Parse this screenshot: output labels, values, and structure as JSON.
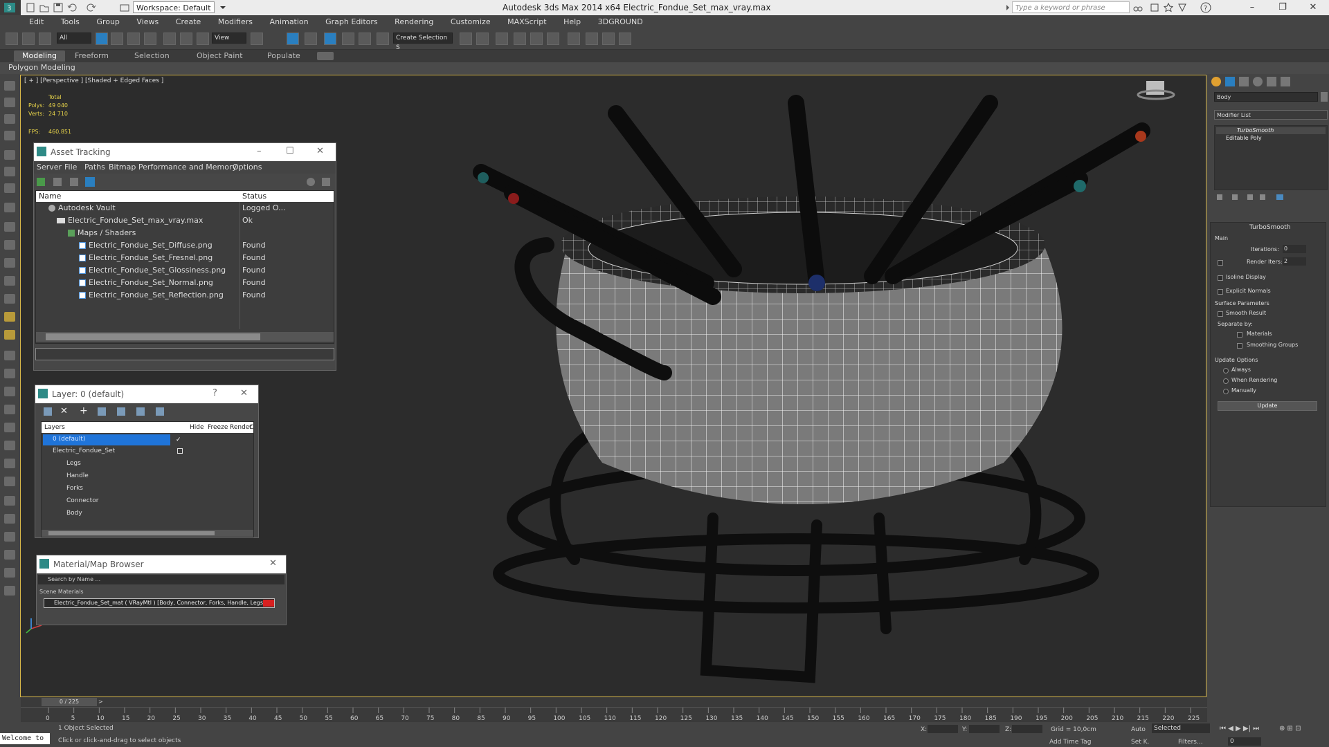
{
  "app": {
    "title": "Autodesk 3ds Max  2014 x64     Electric_Fondue_Set_max_vray.max",
    "workspace": "Workspace: Default",
    "search_placeholder": "Type a keyword or phrase"
  },
  "menu": [
    "Edit",
    "Tools",
    "Group",
    "Views",
    "Create",
    "Modifiers",
    "Animation",
    "Graph Editors",
    "Rendering",
    "Customize",
    "MAXScript",
    "Help",
    "3DGROUND"
  ],
  "toolbar": {
    "filter_value": "All",
    "view_value": "View",
    "selection_set_placeholder": "Create Selection S"
  },
  "ribbon": {
    "tabs": [
      "Modeling",
      "Freeform",
      "Selection",
      "Object Paint",
      "Populate"
    ],
    "subpanel": "Polygon Modeling"
  },
  "viewport": {
    "label": "[ + ] [Perspective ] [Shaded + Edged Faces ]",
    "stats": {
      "total_label": "Total",
      "polys_label": "Polys:",
      "polys_value": "49 040",
      "verts_label": "Verts:",
      "verts_value": "24 710",
      "fps_label": "FPS:",
      "fps_value": "460,851"
    }
  },
  "asset_tracking": {
    "title": "Asset Tracking",
    "menu": [
      "Server",
      "File",
      "Paths",
      "Bitmap Performance and Memory",
      "Options"
    ],
    "columns": [
      "Name",
      "Status"
    ],
    "rows": [
      {
        "name": "Autodesk Vault",
        "status": "Logged O..."
      },
      {
        "name": "Electric_Fondue_Set_max_vray.max",
        "status": "Ok"
      },
      {
        "name": "Maps / Shaders",
        "status": ""
      },
      {
        "name": "Electric_Fondue_Set_Diffuse.png",
        "status": "Found"
      },
      {
        "name": "Electric_Fondue_Set_Fresnel.png",
        "status": "Found"
      },
      {
        "name": "Electric_Fondue_Set_Glossiness.png",
        "status": "Found"
      },
      {
        "name": "Electric_Fondue_Set_Normal.png",
        "status": "Found"
      },
      {
        "name": "Electric_Fondue_Set_Reflection.png",
        "status": "Found"
      }
    ]
  },
  "layer_dialog": {
    "title": "Layer: 0 (default)",
    "help": "?",
    "columns": [
      "Layers",
      "Hide",
      "Freeze",
      "Render",
      "C"
    ],
    "rows": [
      {
        "name": "0 (default)"
      },
      {
        "name": "Electric_Fondue_Set"
      },
      {
        "name": "Legs"
      },
      {
        "name": "Handle"
      },
      {
        "name": "Forks"
      },
      {
        "name": "Connector"
      },
      {
        "name": "Body"
      }
    ]
  },
  "material_browser": {
    "title": "Material/Map Browser",
    "search_placeholder": "Search by Name ...",
    "section": "Scene Materials",
    "item": "Electric_Fondue_Set_mat  ( VRayMtl ) [Body, Connector, Forks, Handle, Legs]"
  },
  "command_panel": {
    "object_name": "Body",
    "modifier_list": "Modifier List",
    "stack": [
      "TurboSmooth",
      "Editable Poly"
    ],
    "rollout_title": "TurboSmooth",
    "main_label": "Main",
    "iterations_label": "Iterations:",
    "iterations_value": "0",
    "render_iters_label": "Render Iters:",
    "render_iters_value": "2",
    "isoline_display": "Isoline Display",
    "explicit_normals": "Explicit Normals",
    "surface_params": "Surface Parameters",
    "smooth_result": "Smooth Result",
    "separate_by": "Separate by:",
    "materials": "Materials",
    "smoothing_groups": "Smoothing Groups",
    "update_options": "Update Options",
    "always": "Always",
    "when_rendering": "When Rendering",
    "manually": "Manually",
    "update_button": "Update"
  },
  "timeline": {
    "frame_counter": "0 / 225",
    "ticks": [
      "0",
      "5",
      "10",
      "15",
      "20",
      "25",
      "30",
      "35",
      "40",
      "45",
      "50",
      "55",
      "60",
      "65",
      "70",
      "75",
      "80",
      "85",
      "90",
      "95",
      "100",
      "105",
      "110",
      "115",
      "120",
      "125",
      "130",
      "135",
      "140",
      "145",
      "150",
      "155",
      "160",
      "165",
      "170",
      "175",
      "180",
      "185",
      "190",
      "195",
      "200",
      "205",
      "210",
      "215",
      "220",
      "225"
    ]
  },
  "status": {
    "maxscript": "Welcome to",
    "selected": "1 Object Selected",
    "prompt": "Click or click-and-drag to select objects",
    "x_label": "X:",
    "y_label": "Y:",
    "z_label": "Z:",
    "grid": "Grid = 10,0cm",
    "auto": "Auto",
    "selected_dropdown": "Selected",
    "set_key": "Set K.",
    "filters": "Filters...",
    "add_time_tag": "Add Time Tag",
    "frame_value": "0"
  }
}
